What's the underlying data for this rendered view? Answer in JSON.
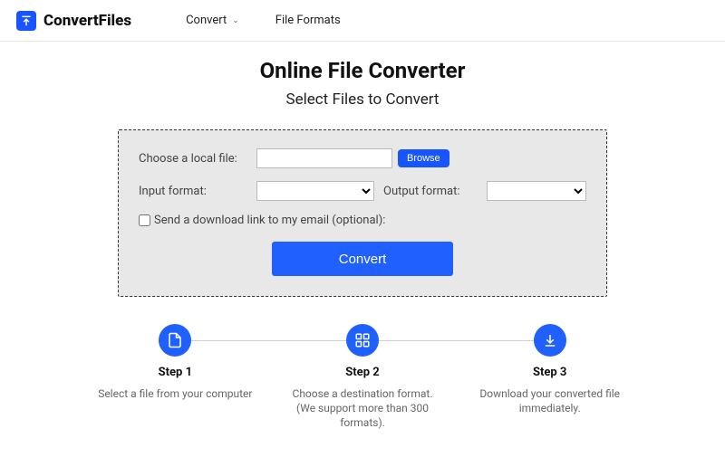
{
  "header": {
    "brand": "ConvertFiles",
    "nav": {
      "convert": "Convert",
      "formats": "File Formats"
    }
  },
  "hero": {
    "title": "Online File Converter",
    "subtitle": "Select Files to Convert"
  },
  "panel": {
    "choose_label": "Choose a local file:",
    "browse": "Browse",
    "input_format_label": "Input format:",
    "output_format_label": "Output format:",
    "email_label": "Send a download link to my email (optional):",
    "convert_label": "Convert",
    "file_value": "",
    "input_format_value": "",
    "output_format_value": ""
  },
  "steps": [
    {
      "title": "Step 1",
      "desc": "Select a file from your computer"
    },
    {
      "title": "Step 2",
      "desc": "Choose a destination format. (We support more than 300 formats)."
    },
    {
      "title": "Step 3",
      "desc": "Download your converted file immediately."
    }
  ]
}
